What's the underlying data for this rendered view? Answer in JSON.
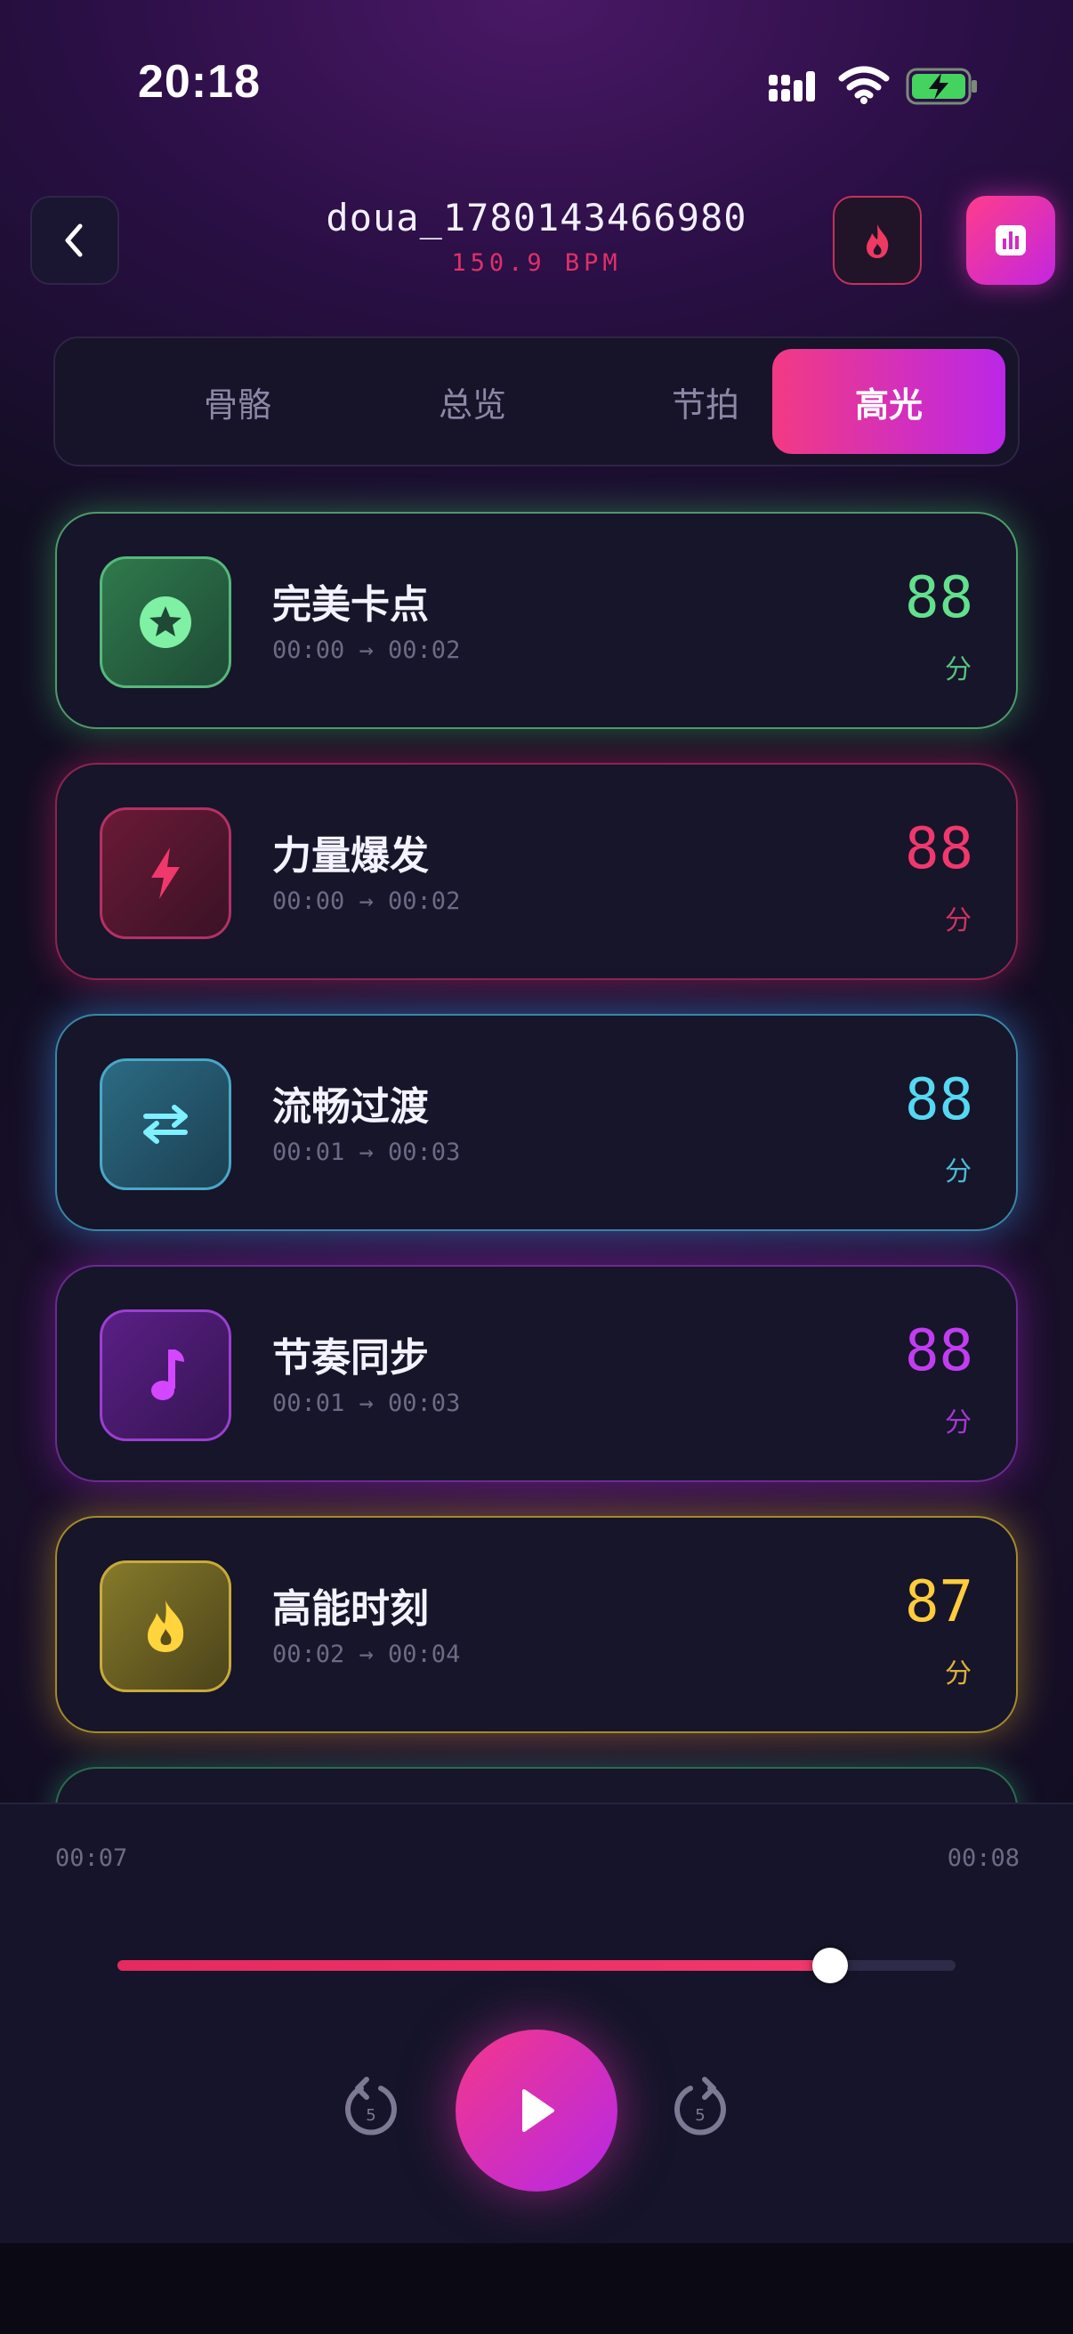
{
  "status_bar": {
    "time": "20:18"
  },
  "header": {
    "title": "doua_1780143466980",
    "bpm": "150.9 BPM"
  },
  "tabs": [
    {
      "label": "骨骼",
      "active": false
    },
    {
      "label": "总览",
      "active": false
    },
    {
      "label": "节拍",
      "active": false
    },
    {
      "label": "高光",
      "active": true
    }
  ],
  "highlights": [
    {
      "name": "完美卡点",
      "range": "00:00 → 00:02",
      "score": "88",
      "unit": "分",
      "icon": "star-icon",
      "color": "#63e08c"
    },
    {
      "name": "力量爆发",
      "range": "00:00 → 00:02",
      "score": "88",
      "unit": "分",
      "icon": "bolt-icon",
      "color": "#f0386d"
    },
    {
      "name": "流畅过渡",
      "range": "00:01 → 00:03",
      "score": "88",
      "unit": "分",
      "icon": "swap-arrows-icon",
      "color": "#56d8f2"
    },
    {
      "name": "节奏同步",
      "range": "00:01 → 00:03",
      "score": "88",
      "unit": "分",
      "icon": "music-note-icon",
      "color": "#c13df0"
    },
    {
      "name": "高能时刻",
      "range": "00:02 → 00:04",
      "score": "87",
      "unit": "分",
      "icon": "flame-icon",
      "color": "#ffcc3c"
    }
  ],
  "player": {
    "current_time": "00:07",
    "end_time": "00:08",
    "progress": 0.85,
    "skip_back_label": "5",
    "skip_forward_label": "5"
  }
}
